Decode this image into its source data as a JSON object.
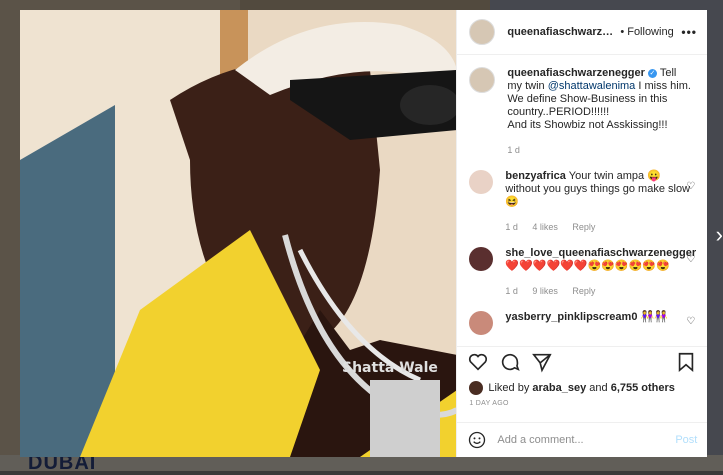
{
  "post": {
    "username": "queenafiaschwarzenegger",
    "header_username": "queenafiaschwarzeneg",
    "dot": "•",
    "follow_label": "Following",
    "more": "•••",
    "caption": {
      "before_mention": "Tell my twin",
      "mention": "@shattawalenima",
      "after_mention": "I miss him.",
      "line2": "We define Show-Business in this country..PERIOD!!!!!!",
      "line3": "And its Showbiz not Asskissing!!!",
      "time": "1 d"
    }
  },
  "comments": [
    {
      "username": "benzyafrica",
      "text": "Your twin ampa 😛 without you guys things go make slow 😆",
      "time": "1 d",
      "likes": "4 likes",
      "reply": "Reply",
      "avatar_color": "#e9d2c6"
    },
    {
      "username": "she_love_queenafiaschwarzenegger",
      "text": "❤️❤️❤️❤️❤️❤️😍😍😍😍😍😍",
      "time": "1 d",
      "likes": "9 likes",
      "reply": "Reply",
      "avatar_color": "#5a2f2f"
    },
    {
      "username": "yasberry_pinklipscream0",
      "text": "👭👭",
      "time": "",
      "likes": "",
      "reply": "",
      "avatar_color": "#c98a7a"
    }
  ],
  "likes": {
    "prefix": "Liked by",
    "user": "araba_sey",
    "middle": "and",
    "count": "6,755 others"
  },
  "timestamp": "1 DAY AGO",
  "add_comment": {
    "placeholder": "Add a comment...",
    "post_label": "Post"
  },
  "background": {
    "feed_text": "DUBAI"
  },
  "icons": [
    "heart-icon",
    "comment-icon",
    "share-icon",
    "bookmark-icon",
    "emoji-icon",
    "more-icon",
    "next-arrow-icon"
  ],
  "colors": {
    "link": "#00376b",
    "verified": "#3897f0",
    "post_button": "#b2dffc",
    "meta": "#8e8e8e"
  }
}
